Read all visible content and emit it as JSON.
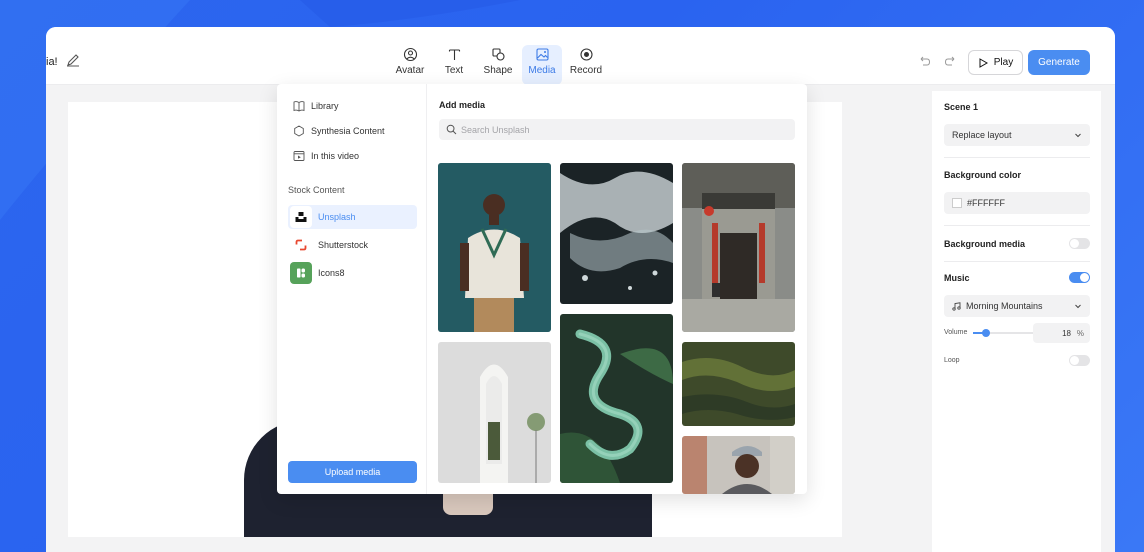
{
  "header": {
    "title_fragment": "ia!",
    "tools": [
      {
        "label": "Avatar",
        "icon": "avatar-icon"
      },
      {
        "label": "Text",
        "icon": "text-icon"
      },
      {
        "label": "Shape",
        "icon": "shape-icon"
      },
      {
        "label": "Media",
        "icon": "media-icon",
        "active": true
      },
      {
        "label": "Record",
        "icon": "record-icon"
      }
    ],
    "play_label": "Play",
    "generate_label": "Generate"
  },
  "media_popover": {
    "nav": [
      {
        "label": "Library",
        "icon": "book-icon"
      },
      {
        "label": "Synthesia Content",
        "icon": "synthesia-icon"
      },
      {
        "label": "In this video",
        "icon": "video-frame-icon"
      }
    ],
    "stock_label": "Stock Content",
    "sources": [
      {
        "label": "Unsplash",
        "icon": "unsplash-logo",
        "active": true
      },
      {
        "label": "Shutterstock",
        "icon": "shutterstock-logo"
      },
      {
        "label": "Icons8",
        "icon": "icons8-logo"
      }
    ],
    "upload_label": "Upload media",
    "add_media_title": "Add media",
    "search_placeholder": "Search Unsplash",
    "thumbnails": [
      {
        "subject": "man in white knit sweater vest"
      },
      {
        "subject": "aerial ocean waves on black sand"
      },
      {
        "subject": "chinese temple gate with red lanterns"
      },
      {
        "subject": "white arched window on wall"
      },
      {
        "subject": "green snake on leaves"
      },
      {
        "subject": "aerial green textured landscape"
      },
      {
        "subject": "man with cap and beard"
      }
    ]
  },
  "properties_panel": {
    "scene_title": "Scene 1",
    "layout_select": "Replace layout",
    "background_color_label": "Background color",
    "background_color_value": "#FFFFFF",
    "background_media_label": "Background media",
    "background_media_on": false,
    "music_label": "Music",
    "music_on": true,
    "music_track": "Morning Mountains",
    "volume_label": "Volume",
    "volume_value": "18",
    "volume_unit": "%",
    "volume_level": 0.18,
    "loop_label": "Loop",
    "loop_on": false
  },
  "colors": {
    "accent": "#4a8df1",
    "background_gradient": "#2c66ee"
  }
}
